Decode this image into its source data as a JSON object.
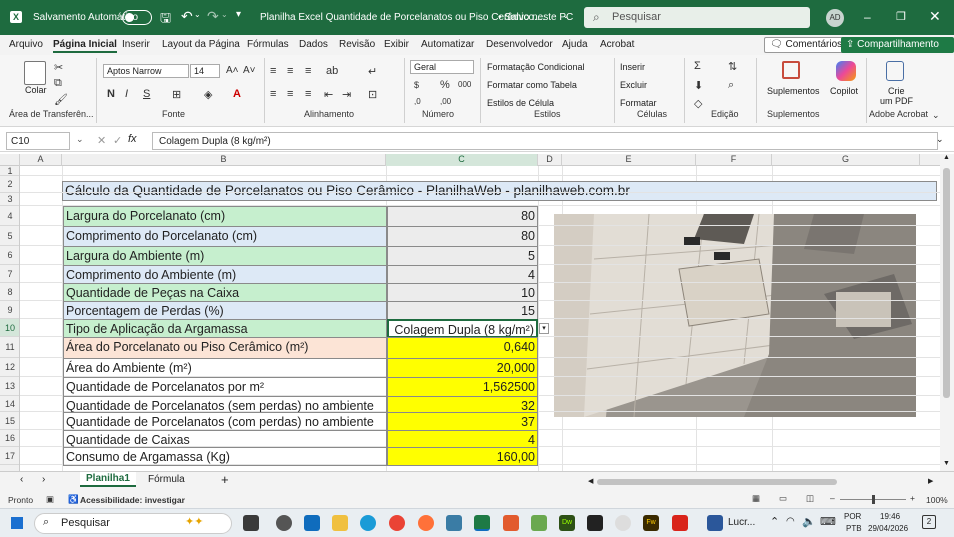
{
  "titlebar": {
    "autosave_label": "Salvamento Automático",
    "doc_title": "Planilha Excel Quantidade de Porcelanatos ou Piso Cerâmico....",
    "save_state": "• Salvo neste PC",
    "search_placeholder": "Pesquisar",
    "avatar": "AD"
  },
  "menu": {
    "items": [
      "Arquivo",
      "Página Inicial",
      "Inserir",
      "Layout da Página",
      "Fórmulas",
      "Dados",
      "Revisão",
      "Exibir",
      "Automatizar",
      "Desenvolvedor",
      "Ajuda",
      "Acrobat"
    ],
    "comments": "Comentários",
    "share": "Compartilhamento"
  },
  "ribbon": {
    "paste": "Colar",
    "clipboard": "Área de Transferên...",
    "font_name": "Aptos Narrow",
    "font_size": "14",
    "font_group": "Fonte",
    "alignment_group": "Alinhamento",
    "number_format": "Geral",
    "number_group": "Número",
    "cond_format": "Formatação Condicional",
    "format_table": "Formatar como Tabela",
    "cell_styles": "Estilos de Célula",
    "styles_group": "Estilos",
    "insert": "Inserir",
    "delete": "Excluir",
    "format": "Formatar",
    "cells_group": "Células",
    "editing_group": "Edição",
    "addins": "Suplementos",
    "addins_group": "Suplementos",
    "copilot": "Copilot",
    "create_pdf_1": "Crie",
    "create_pdf_2": "um PDF",
    "acrobat_group": "Adobe Acrobat"
  },
  "formula_bar": {
    "name_box": "C10",
    "formula": "Colagem Dupla (8 kg/m²)"
  },
  "columns": [
    "A",
    "B",
    "C",
    "D",
    "E",
    "F",
    "G"
  ],
  "rows": [
    "1",
    "2",
    "3",
    "4",
    "5",
    "6",
    "7",
    "8",
    "9",
    "10",
    "11",
    "12",
    "13",
    "14",
    "15",
    "16",
    "17"
  ],
  "sheet": {
    "title": "Cálculo da Quantidade de Porcelanatos ou Piso Cerâmico - PlanilhaWeb - planilhaweb.com.br",
    "inputs": [
      {
        "label": "Largura do Porcelanato (cm)",
        "value": "80"
      },
      {
        "label": "Comprimento do Porcelanato (cm)",
        "value": "80"
      },
      {
        "label": "Largura do Ambiente (m)",
        "value": "5"
      },
      {
        "label": "Comprimento do Ambiente (m)",
        "value": "4"
      },
      {
        "label": "Quantidade de Peças na Caixa",
        "value": "10"
      },
      {
        "label": "Porcentagem de Perdas (%)",
        "value": "15"
      },
      {
        "label": "Tipo de Aplicação da Argamassa",
        "value": "Colagem Dupla (8 kg/m²)"
      }
    ],
    "results": [
      {
        "label": "Área do Porcelanato ou Piso Cerâmico (m²)",
        "value": "0,640"
      },
      {
        "label": "Área do Ambiente (m²)",
        "value": "20,000"
      },
      {
        "label": "Quantidade de Porcelanatos por m²",
        "value": "1,562500"
      },
      {
        "label": "Quantidade de Porcelanatos  (sem perdas) no ambiente",
        "value": "32"
      },
      {
        "label": "Quantidade de Porcelanatos  (com perdas) no ambiente",
        "value": "37"
      },
      {
        "label": "Quantidade de Caixas",
        "value": "4"
      },
      {
        "label": "Consumo de Argamassa (Kg)",
        "value": "160,00"
      }
    ]
  },
  "sheet_tabs": {
    "active": "Planilha1",
    "other": "Fórmula"
  },
  "status": {
    "ready": "Pronto",
    "accessibility": "Acessibilidade: investigar",
    "zoom": "100%"
  },
  "taskbar": {
    "search": "Pesquisar",
    "app_label": "Lucr...",
    "lang1": "POR",
    "lang2": "PTB",
    "time": "19:46",
    "date": "29/04/2026",
    "notif": "2"
  }
}
